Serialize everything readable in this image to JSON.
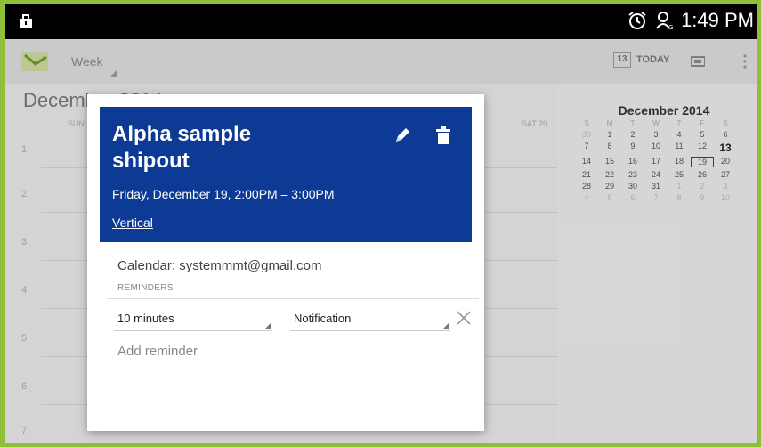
{
  "status_bar": {
    "time": "1:49 PM",
    "left_icon": "bag-notification-icon",
    "icons": [
      "alarm-icon",
      "network-icon"
    ]
  },
  "action_bar": {
    "view_mode": "Week",
    "today_label": "TODAY",
    "today_badge": "13"
  },
  "week_view": {
    "month_heading": "December 2014",
    "day_heads": [
      "SUN",
      "SAT 20"
    ],
    "hours": [
      "1",
      "2",
      "3",
      "4",
      "5",
      "6",
      "7"
    ]
  },
  "mini_calendar": {
    "title": "December 2014",
    "day_headers": [
      "S",
      "M",
      "T",
      "W",
      "T",
      "F",
      "S"
    ],
    "weeks": [
      [
        "30",
        "1",
        "2",
        "3",
        "4",
        "5",
        "6"
      ],
      [
        "7",
        "8",
        "9",
        "10",
        "11",
        "12",
        "13"
      ],
      [
        "14",
        "15",
        "16",
        "17",
        "18",
        "19",
        "20"
      ],
      [
        "21",
        "22",
        "23",
        "24",
        "25",
        "26",
        "27"
      ],
      [
        "28",
        "29",
        "30",
        "31",
        "1",
        "2",
        "3"
      ],
      [
        "4",
        "5",
        "6",
        "7",
        "8",
        "9",
        "10"
      ]
    ],
    "selected": "19",
    "today": "13"
  },
  "event": {
    "title": "Alpha sample shipout",
    "time": "Friday, December 19, 2:00PM – 3:00PM",
    "location": "Vertical",
    "calendar": "Calendar: systemmmt@gmail.com",
    "reminders_heading": "REMINDERS",
    "reminder_time": "10 minutes",
    "reminder_method": "Notification",
    "add_reminder": "Add reminder"
  },
  "colors": {
    "header_blue": "#0d3a95",
    "frame_green": "#8fbf3a"
  }
}
